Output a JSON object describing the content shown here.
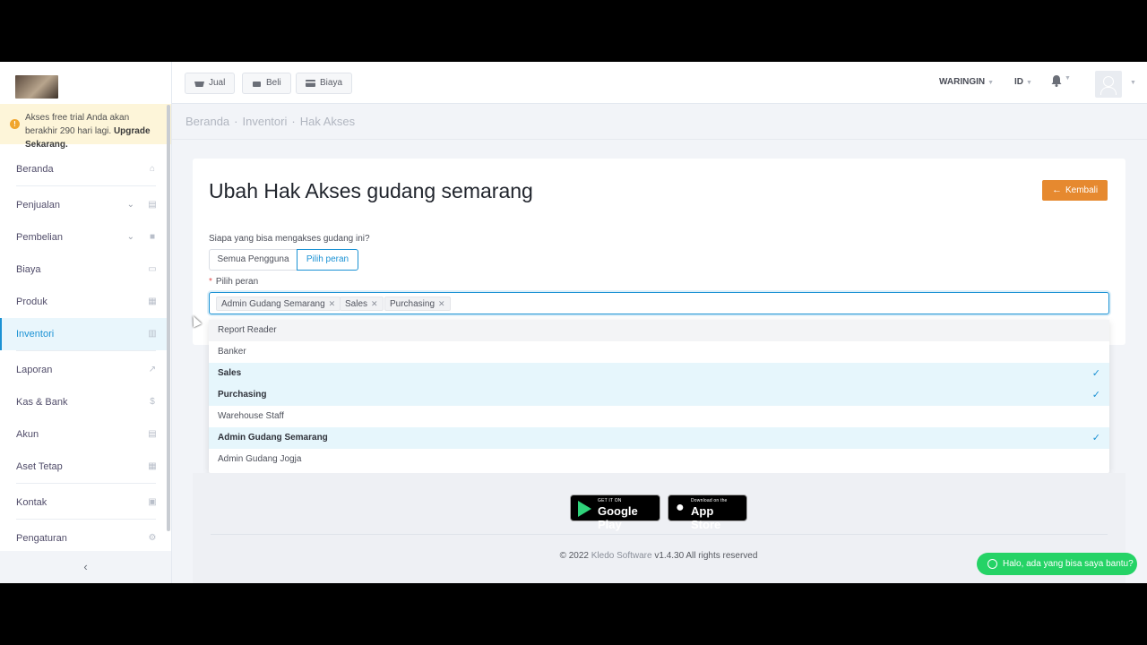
{
  "trial": {
    "text": "Akses free trial Anda akan berakhir 290 hari lagi.",
    "upgrade": "Upgrade Sekarang."
  },
  "sidebar": {
    "items": [
      {
        "label": "Beranda",
        "icon": "home-icon"
      },
      {
        "label": "Penjualan",
        "icon": "basket-icon"
      },
      {
        "label": "Pembelian",
        "icon": "bag-icon"
      },
      {
        "label": "Biaya",
        "icon": "card-icon"
      },
      {
        "label": "Produk",
        "icon": "box-icon"
      },
      {
        "label": "Inventori",
        "icon": "warehouse-icon"
      },
      {
        "label": "Laporan",
        "icon": "chart-icon"
      },
      {
        "label": "Kas & Bank",
        "icon": "dollar-icon"
      },
      {
        "label": "Akun",
        "icon": "list-icon"
      },
      {
        "label": "Aset Tetap",
        "icon": "building-icon"
      },
      {
        "label": "Kontak",
        "icon": "contact-card-icon"
      },
      {
        "label": "Pengaturan",
        "icon": "gears-icon"
      }
    ],
    "collapse": "‹"
  },
  "topbar": {
    "jual": "Jual",
    "beli": "Beli",
    "biaya": "Biaya",
    "company": "WARINGIN",
    "lang": "ID"
  },
  "breadcrumb": [
    "Beranda",
    "Inventori",
    "Hak Akses"
  ],
  "page": {
    "title": "Ubah Hak Akses gudang semarang",
    "back": "Kembali",
    "question": "Siapa yang bisa mengakses gudang ini?",
    "seg_all": "Semua Pengguna",
    "seg_role": "Pilih peran",
    "field_label": "Pilih peran",
    "tags": [
      "Admin Gudang Semarang",
      "Sales",
      "Purchasing"
    ],
    "options": [
      {
        "label": "Report Reader",
        "selected": false
      },
      {
        "label": "Banker",
        "selected": false
      },
      {
        "label": "Sales",
        "selected": true
      },
      {
        "label": "Purchasing",
        "selected": true
      },
      {
        "label": "Warehouse Staff",
        "selected": false
      },
      {
        "label": "Admin Gudang Semarang",
        "selected": true
      },
      {
        "label": "Admin Gudang Jogja",
        "selected": false
      }
    ]
  },
  "footer": {
    "gp_small": "GET IT ON",
    "gp_big": "Google Play",
    "as_small": "Download on the",
    "as_big": "App Store",
    "copy_pre": "© 2022",
    "copy_brand": "Kledo Software",
    "copy_post": "v1.4.30 All rights reserved",
    "chat": "Halo, ada yang bisa saya bantu?"
  },
  "colors": {
    "accent": "#1b92d4",
    "back_button": "#e6892f",
    "chat": "#25d366"
  }
}
